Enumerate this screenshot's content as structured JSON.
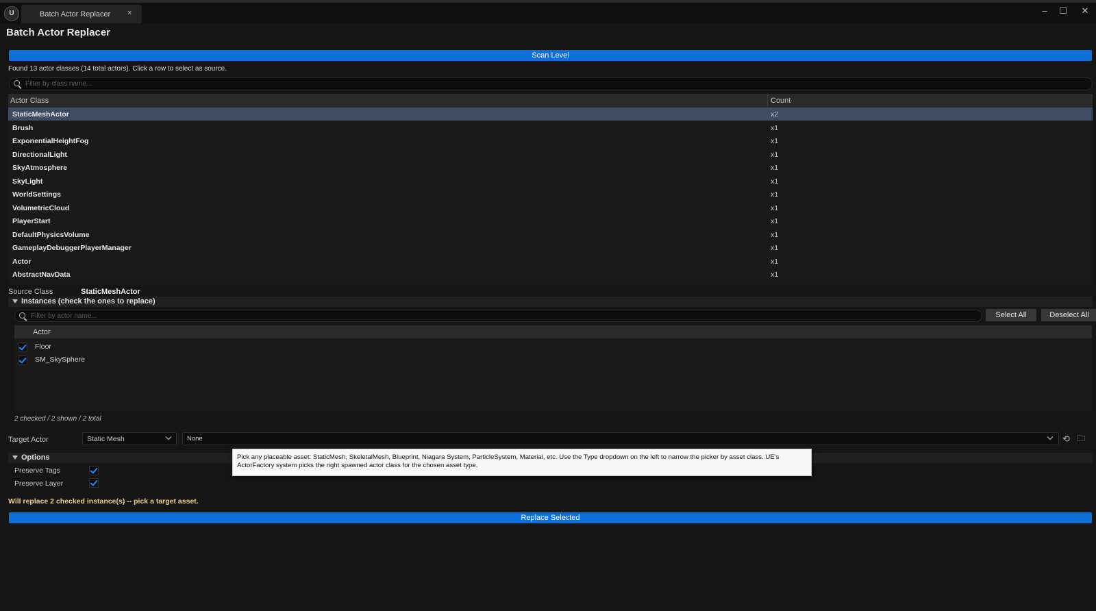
{
  "window": {
    "tab_title": "Batch Actor Replacer",
    "tab_close": "×",
    "logo": "U",
    "controls": {
      "minimize": "–",
      "maximize": "☐",
      "close": "✕"
    }
  },
  "panel": {
    "title": "Batch Actor Replacer"
  },
  "scan": {
    "button_label": "Scan Level",
    "found_text": "Found 13 actor classes (14 total actors). Click a row to select as source."
  },
  "class_filter": {
    "placeholder": "Filter by class name..."
  },
  "class_table": {
    "columns": [
      "Actor Class",
      "Count"
    ],
    "rows": [
      {
        "name": "StaticMeshActor",
        "count": "x2",
        "selected": true
      },
      {
        "name": "Brush",
        "count": "x1"
      },
      {
        "name": "ExponentialHeightFog",
        "count": "x1"
      },
      {
        "name": "DirectionalLight",
        "count": "x1"
      },
      {
        "name": "SkyAtmosphere",
        "count": "x1"
      },
      {
        "name": "SkyLight",
        "count": "x1"
      },
      {
        "name": "WorldSettings",
        "count": "x1"
      },
      {
        "name": "VolumetricCloud",
        "count": "x1"
      },
      {
        "name": "PlayerStart",
        "count": "x1"
      },
      {
        "name": "DefaultPhysicsVolume",
        "count": "x1"
      },
      {
        "name": "GameplayDebuggerPlayerManager",
        "count": "x1"
      },
      {
        "name": "Actor",
        "count": "x1"
      },
      {
        "name": "AbstractNavData",
        "count": "x1"
      }
    ]
  },
  "source": {
    "label": "Source Class",
    "value": "StaticMeshActor"
  },
  "instances": {
    "section_label": "Instances (check the ones to replace)",
    "filter_placeholder": "Filter by actor name...",
    "select_all": "Select All",
    "deselect_all": "Deselect All",
    "column": "Actor",
    "rows": [
      {
        "name": "Floor",
        "checked": true
      },
      {
        "name": "SM_SkySphere",
        "checked": true
      }
    ],
    "counts": "2 checked / 2 shown / 2 total"
  },
  "target": {
    "label": "Target Actor",
    "type_value": "Static Mesh",
    "asset_value": "None"
  },
  "options": {
    "section_label": "Options",
    "preserve_tags": {
      "label": "Preserve Tags",
      "checked": true
    },
    "preserve_layer": {
      "label": "Preserve Layer",
      "checked": true
    }
  },
  "tooltip": {
    "text": "Pick any placeable asset: StaticMesh, SkeletalMesh, Blueprint, Niagara System, ParticleSystem, Material, etc. Use the Type dropdown on the left to narrow the picker by asset class. UE's ActorFactory system picks the right spawned actor class for the chosen asset type."
  },
  "status": {
    "text": "Will replace 2 checked instance(s) -- pick a target asset."
  },
  "replace": {
    "button_label": "Replace Selected"
  },
  "colors": {
    "accent": "#0e6fd8",
    "selected_row": "#3d4b63",
    "status_text": "#ecd08a",
    "background": "#151515"
  }
}
